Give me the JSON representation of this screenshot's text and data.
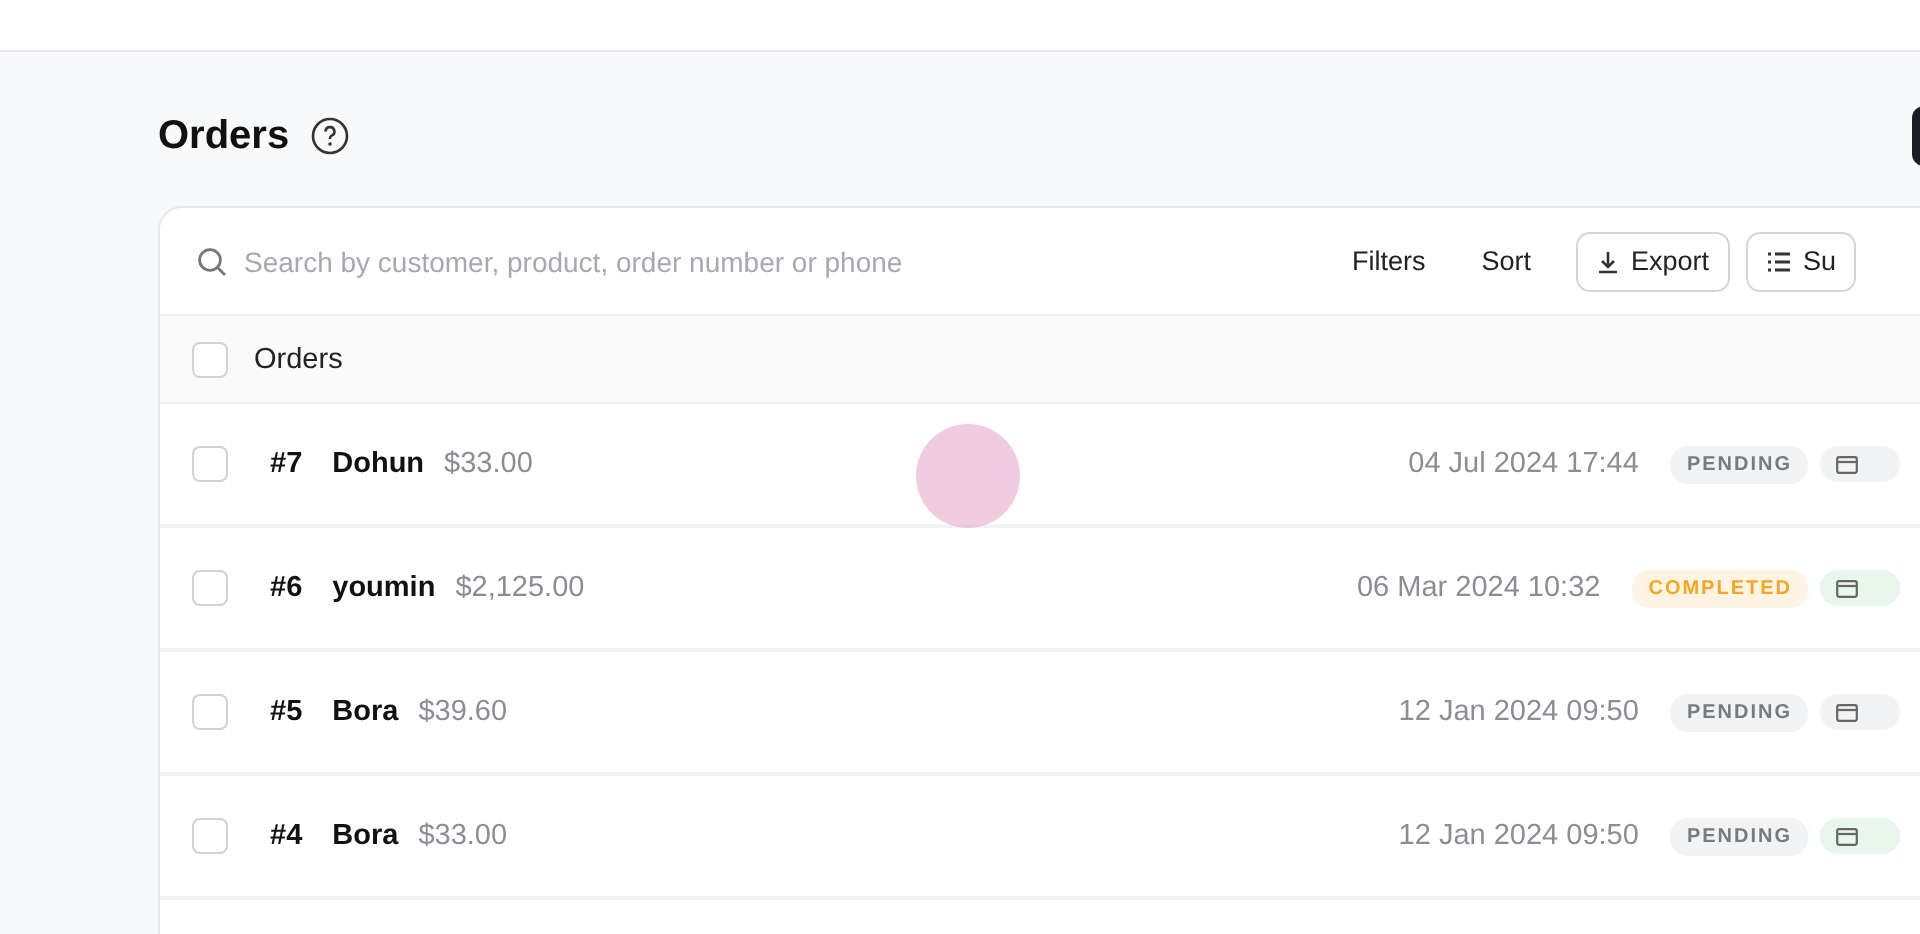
{
  "page": {
    "title": "Orders"
  },
  "toolbar": {
    "search": {
      "placeholder": "Search by customer, product, order number or phone"
    },
    "buttons": [
      {
        "label": "Filters",
        "kind": "plain"
      },
      {
        "label": "Sort",
        "kind": "plain"
      },
      {
        "label": "Export",
        "kind": "export"
      },
      {
        "label": "Su",
        "kind": "summary"
      }
    ]
  },
  "table": {
    "header": {
      "label": "Orders",
      "checked": false
    },
    "rows": [
      {
        "checked": false,
        "number": "#7",
        "customer": "Dohun",
        "total": "$33.00",
        "date": "04 Jul 2024 17:44",
        "status": {
          "label": "PENDING",
          "kind": "pending"
        },
        "payment": {
          "color": "#f1f3f5"
        }
      },
      {
        "checked": false,
        "number": "#6",
        "customer": "youmin",
        "total": "$2,125.00",
        "date": "06 Mar 2024 10:32",
        "status": {
          "label": "COMPLETED",
          "kind": "completed"
        },
        "payment": {
          "color": "#e8f6ec"
        }
      },
      {
        "checked": false,
        "number": "#5",
        "customer": "Bora",
        "total": "$39.60",
        "date": "12 Jan 2024 09:50",
        "status": {
          "label": "PENDING",
          "kind": "pending"
        },
        "payment": {
          "color": "#f1f3f5"
        }
      },
      {
        "checked": false,
        "number": "#4",
        "customer": "Bora",
        "total": "$33.00",
        "date": "12 Jan 2024 09:50",
        "status": {
          "label": "PENDING",
          "kind": "pending"
        },
        "payment": {
          "color": "#e8f6ec"
        }
      }
    ]
  }
}
